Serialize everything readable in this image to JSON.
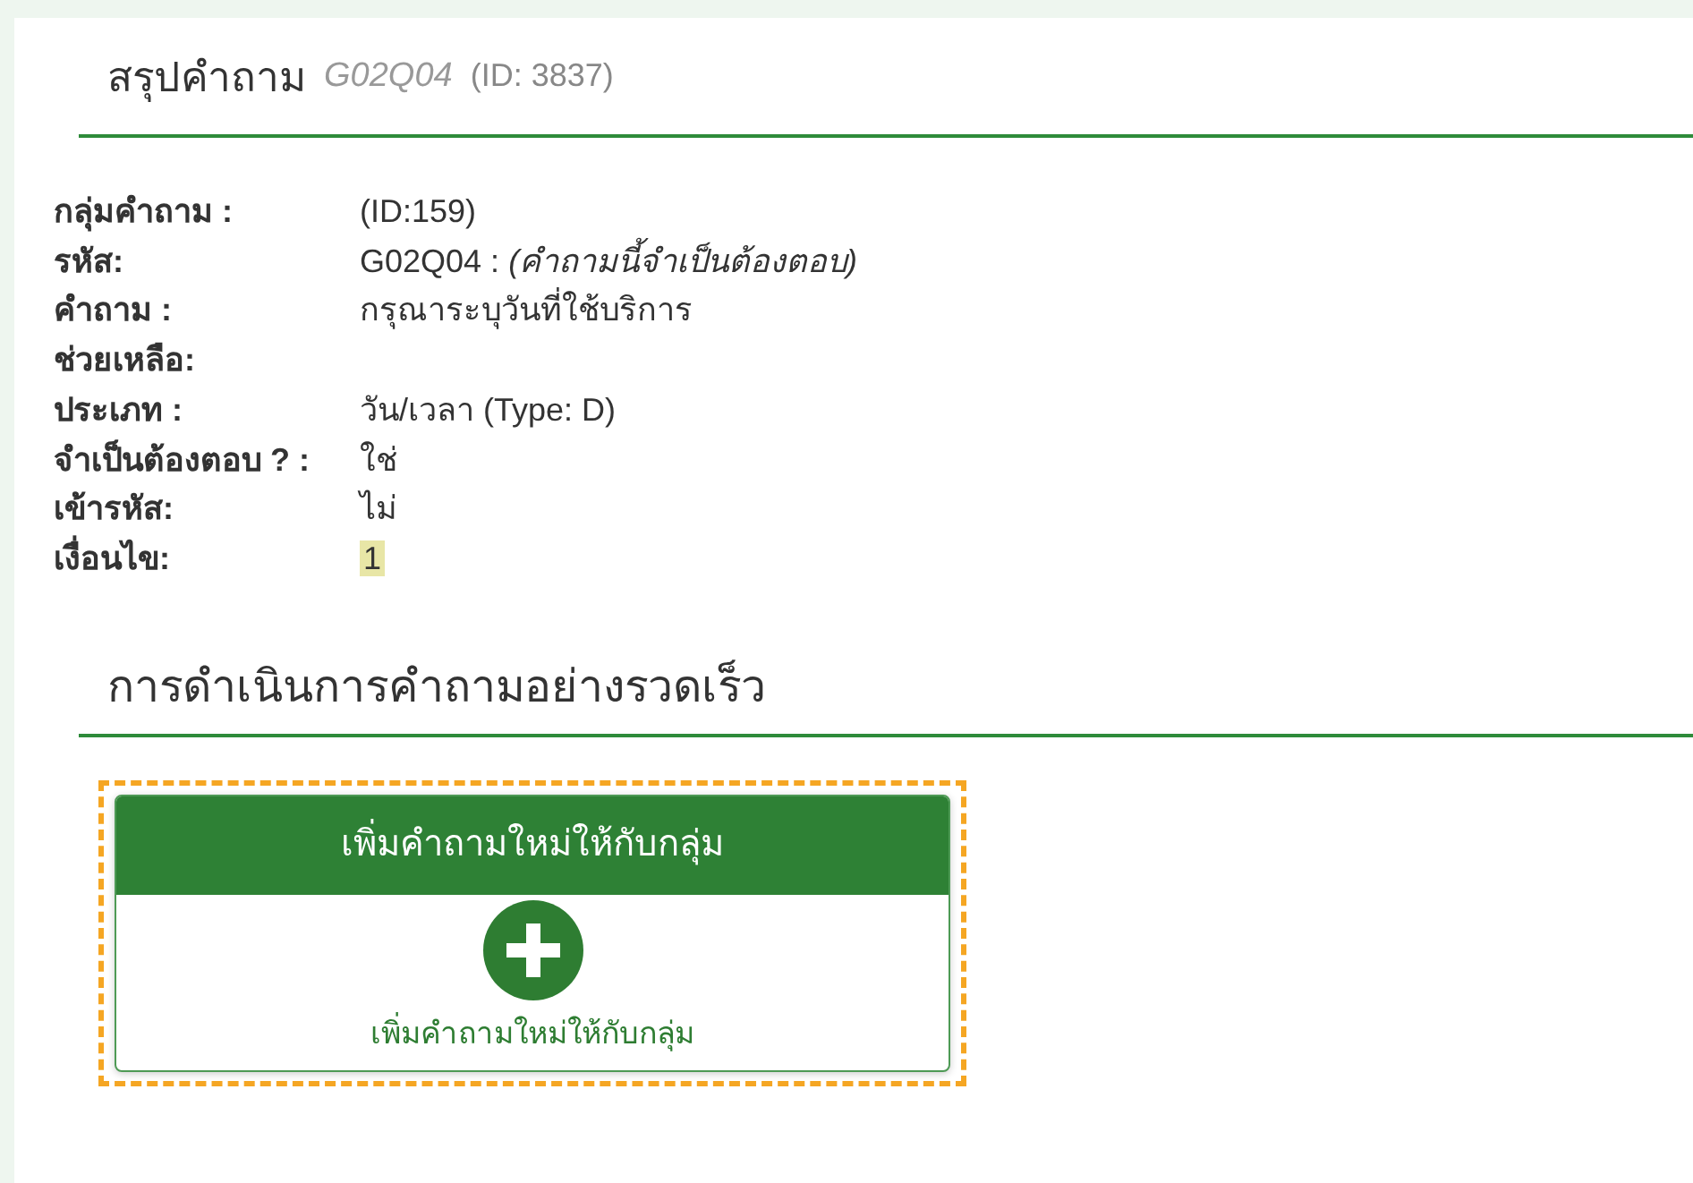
{
  "summary": {
    "title": "สรุปคำถาม",
    "code": "G02Q04",
    "id": "(ID: 3837)"
  },
  "details": [
    {
      "label": "กลุ่มคำถาม :",
      "value": "(ID:159)",
      "kind": "text"
    },
    {
      "label": "รหัส:",
      "value": "G02Q04 : *(คำถามนี้จำเป็นต้องตอบ)*",
      "kind": "text"
    },
    {
      "label": "คำถาม :",
      "value": "กรุณาระบุวันที่ใช้บริการ",
      "kind": "text"
    },
    {
      "label": "ช่วยเหลือ:"
    },
    {
      "label": "ประเภท :",
      "value": "วัน/เวลา (Type: D)",
      "kind": "text"
    },
    {
      "label": "จำเป็นต้องตอบ ? :",
      "value": "ใช่",
      "kind": "text"
    },
    {
      "label": "เข้ารหัส:",
      "value": "ไม่",
      "kind": "text"
    },
    {
      "label": "เงื่อนไข:",
      "value": "1",
      "kind": "badge"
    }
  ],
  "quick_actions": {
    "title": "การดำเนินการคำถามอย่างรวดเร็ว",
    "cards": [
      {
        "header": "เพิ่มคำถามใหม่ให้กับกลุ่ม",
        "caption": "เพิ่มคำถามใหม่ให้กับกลุ่ม",
        "highlighted": true
      }
    ]
  }
}
